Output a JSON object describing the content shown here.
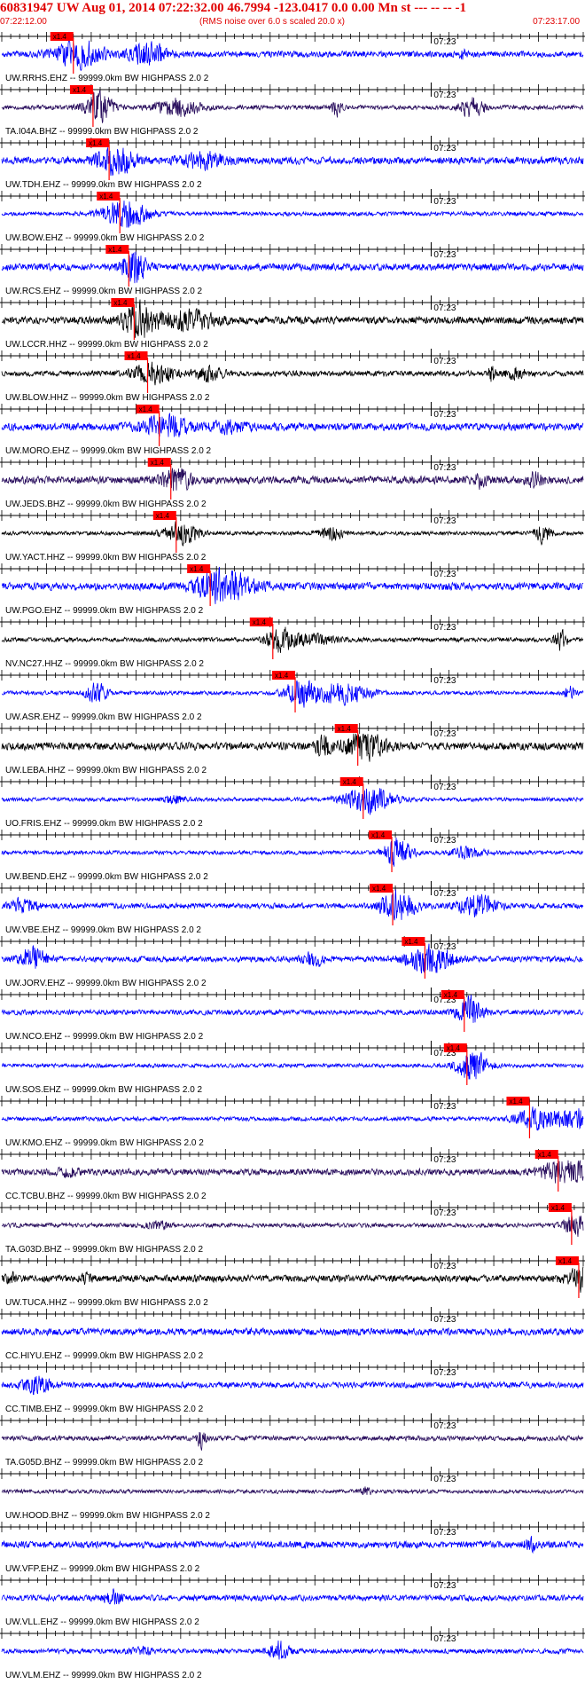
{
  "header": {
    "title": "60831947 UW Aug 01, 2014 07:22:32.00   46.7994 -123.0417  0.0 0.00 Mn st --- -- --   -1",
    "start_time": "07:22:12.00",
    "rms_note": "(RMS noise over 6.0 s scaled 20.0 x)",
    "end_time": "07:23:17.00"
  },
  "chart_data": {
    "type": "line",
    "title": "60831947 UW Aug 01, 2014 07:22:32.00   46.7994 -123.0417  0.0 0.00 Mn st --- -- --   -1",
    "x_range": [
      "07:22:12.00",
      "07:23:17.00"
    ],
    "x_range_seconds": [
      0,
      65
    ],
    "minute_mark": {
      "label": "07:23",
      "t": 48
    },
    "pick_label": "x1.4",
    "colors": {
      "blue": "#0000ff",
      "black": "#000000",
      "purple": "#2a0f5e",
      "pick": "#ff0000"
    },
    "traces": [
      {
        "label": "UW.RRHS.EHZ -- 99999.0km BW  HIGHPASS  2.0  2",
        "color": "blue",
        "pick_t": 8.0
      },
      {
        "label": "TA.I04A.BHZ -- 99999.0km BW  HIGHPASS  2.0  2",
        "color": "purple",
        "pick_t": 10.2
      },
      {
        "label": "UW.TDH.EHZ -- 99999.0km BW  HIGHPASS  2.0  2",
        "color": "blue",
        "pick_t": 12.0
      },
      {
        "label": "UW.BOW.EHZ -- 99999.0km BW  HIGHPASS  2.0  2",
        "color": "blue",
        "pick_t": 13.2
      },
      {
        "label": "UW.RCS.EHZ -- 99999.0km BW  HIGHPASS  2.0  2",
        "color": "blue",
        "pick_t": 14.2
      },
      {
        "label": "UW.LCCR.HHZ -- 99999.0km BW  HIGHPASS  2.0  2",
        "color": "black",
        "pick_t": 14.8
      },
      {
        "label": "UW.BLOW.HHZ -- 99999.0km BW  HIGHPASS  2.0  2",
        "color": "black",
        "pick_t": 16.3
      },
      {
        "label": "UW.MORO.EHZ -- 99999.0km BW  HIGHPASS  2.0  2",
        "color": "blue",
        "pick_t": 17.6
      },
      {
        "label": "UW.JEDS.BHZ -- 99999.0km BW  HIGHPASS  2.0  2",
        "color": "purple",
        "pick_t": 18.9
      },
      {
        "label": "UW.YACT.HHZ -- 99999.0km BW  HIGHPASS  2.0  2",
        "color": "black",
        "pick_t": 19.5
      },
      {
        "label": "UW.PGO.EHZ -- 99999.0km BW  HIGHPASS  2.0  2",
        "color": "blue",
        "pick_t": 23.3
      },
      {
        "label": "NV.NC27.HHZ -- 99999.0km BW  HIGHPASS  2.0  2",
        "color": "black",
        "pick_t": 30.3
      },
      {
        "label": "UW.ASR.EHZ -- 99999.0km BW  HIGHPASS  2.0  2",
        "color": "blue",
        "pick_t": 32.8
      },
      {
        "label": "UW.LEBA.HHZ -- 99999.0km BW  HIGHPASS  2.0  2",
        "color": "black",
        "pick_t": 39.8
      },
      {
        "label": "UO.FRIS.EHZ -- 99999.0km BW  HIGHPASS  2.0  2",
        "color": "blue",
        "pick_t": 40.4
      },
      {
        "label": "UW.BEND.EHZ -- 99999.0km BW  HIGHPASS  2.0  2",
        "color": "blue",
        "pick_t": 43.6
      },
      {
        "label": "UW.VBE.EHZ -- 99999.0km BW  HIGHPASS  2.0  2",
        "color": "blue",
        "pick_t": 43.7
      },
      {
        "label": "UW.JORV.EHZ -- 99999.0km BW  HIGHPASS  2.0  2",
        "color": "blue",
        "pick_t": 47.3
      },
      {
        "label": "UW.NCO.EHZ -- 99999.0km BW  HIGHPASS  2.0  2",
        "color": "blue",
        "pick_t": 51.7
      },
      {
        "label": "UW.SOS.EHZ -- 99999.0km BW  HIGHPASS  2.0  2",
        "color": "blue",
        "pick_t": 52.0
      },
      {
        "label": "UW.KMO.EHZ -- 99999.0km BW  HIGHPASS  2.0  2",
        "color": "blue",
        "pick_t": 59.0
      },
      {
        "label": "CC.TCBU.BHZ -- 99999.0km BW  HIGHPASS  2.0  2",
        "color": "purple",
        "pick_t": 62.2
      },
      {
        "label": "TA.G03D.BHZ -- 99999.0km BW  HIGHPASS  2.0  2",
        "color": "purple",
        "pick_t": 63.7
      },
      {
        "label": "UW.TUCA.HHZ -- 99999.0km BW  HIGHPASS  2.0  2",
        "color": "black",
        "pick_t": 64.5
      },
      {
        "label": "CC.HIYU.EHZ -- 99999.0km BW  HIGHPASS  2.0  2",
        "color": "blue",
        "pick_t": null
      },
      {
        "label": "CC.TIMB.EHZ -- 99999.0km BW  HIGHPASS  2.0  2",
        "color": "blue",
        "pick_t": null
      },
      {
        "label": "TA.G05D.BHZ -- 99999.0km BW  HIGHPASS  2.0  2",
        "color": "purple",
        "pick_t": null
      },
      {
        "label": "UW.HOOD.BHZ -- 99999.0km BW  HIGHPASS  2.0  2",
        "color": "purple",
        "pick_t": null
      },
      {
        "label": "UW.VFP.EHZ -- 99999.0km BW  HIGHPASS  2.0  2",
        "color": "blue",
        "pick_t": null
      },
      {
        "label": "UW.VLL.EHZ -- 99999.0km BW  HIGHPASS  2.0  2",
        "color": "blue",
        "pick_t": null
      },
      {
        "label": "UW.VLM.EHZ -- 99999.0km BW  HIGHPASS  2.0  2",
        "color": "blue",
        "pick_t": null
      }
    ]
  }
}
